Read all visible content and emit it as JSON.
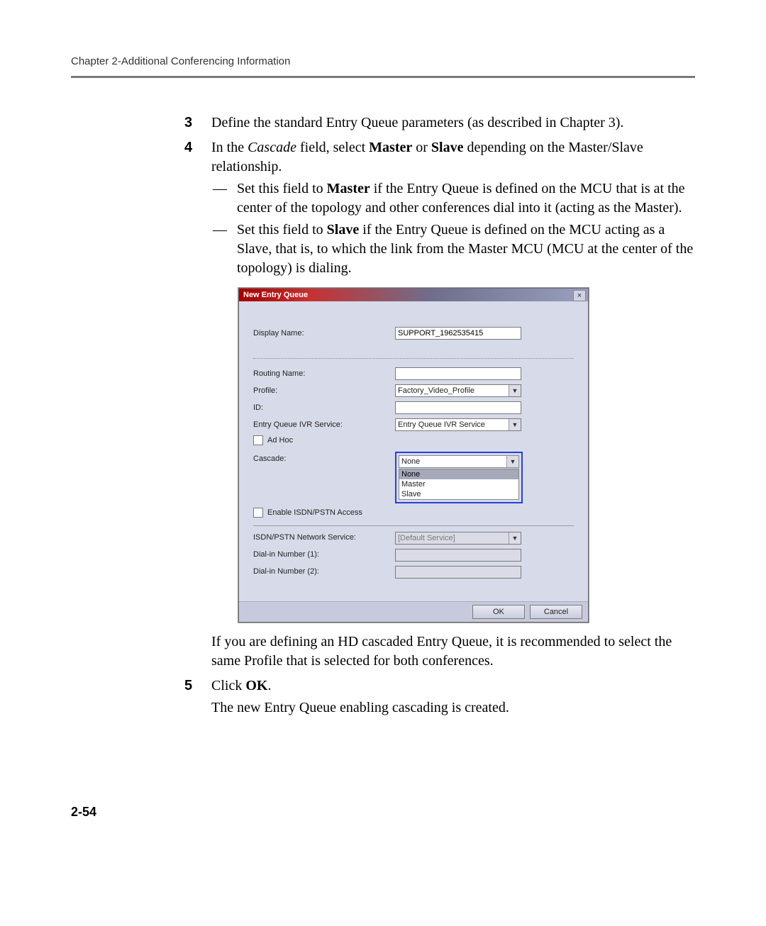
{
  "header": "Chapter 2-Additional Conferencing Information",
  "steps": {
    "s3": {
      "num": "3",
      "text_a": "Define the standard Entry Queue parameters (as described in Chapter 3)."
    },
    "s4": {
      "num": "4",
      "intro_a": "In the ",
      "intro_italic": "Cascade",
      "intro_b": " field, select ",
      "intro_bold1": "Master",
      "intro_c": " or ",
      "intro_bold2": "Slave",
      "intro_d": " depending on the Master/Slave relationship.",
      "b1_a": "Set this field to ",
      "b1_bold": "Master",
      "b1_b": " if the Entry Queue is defined on the MCU that is at the center of the topology and other conferences dial into it (acting as the Master).",
      "b2_a": "Set this field to ",
      "b2_bold": "Slave",
      "b2_b": " if the Entry Queue is defined on the MCU acting as a Slave, that is, to which the link from the Master MCU (MCU at the center of the topology) is dialing."
    },
    "after_dialog": "If you are defining an HD cascaded Entry Queue, it is recommended to select the same Profile that is selected for both conferences.",
    "s5": {
      "num": "5",
      "text_a": "Click ",
      "text_bold": "OK",
      "text_b": ".",
      "followup": "The new Entry Queue enabling cascading is created."
    }
  },
  "dialog": {
    "title": "New Entry Queue",
    "close": "×",
    "labels": {
      "displayName": "Display Name:",
      "routingName": "Routing Name:",
      "profile": "Profile:",
      "id": "ID:",
      "ivr": "Entry Queue IVR Service:",
      "adhoc": "Ad Hoc",
      "cascade": "Cascade:",
      "enableISDN": "Enable ISDN/PSTN Access",
      "isdnService": "ISDN/PSTN Network Service:",
      "dial1": "Dial-in Number (1):",
      "dial2": "Dial-in Number (2):"
    },
    "values": {
      "displayName": "SUPPORT_1962535415",
      "routingName": "",
      "profile": "Factory_Video_Profile",
      "id": "",
      "ivr": "Entry Queue IVR Service",
      "cascadeSelected": "None",
      "cascadeOptions": [
        "None",
        "Master",
        "Slave"
      ],
      "isdnService": "[Default Service]",
      "dial1": "",
      "dial2": ""
    },
    "buttons": {
      "ok": "OK",
      "cancel": "Cancel"
    }
  },
  "pageNumber": "2-54",
  "dash": "—"
}
